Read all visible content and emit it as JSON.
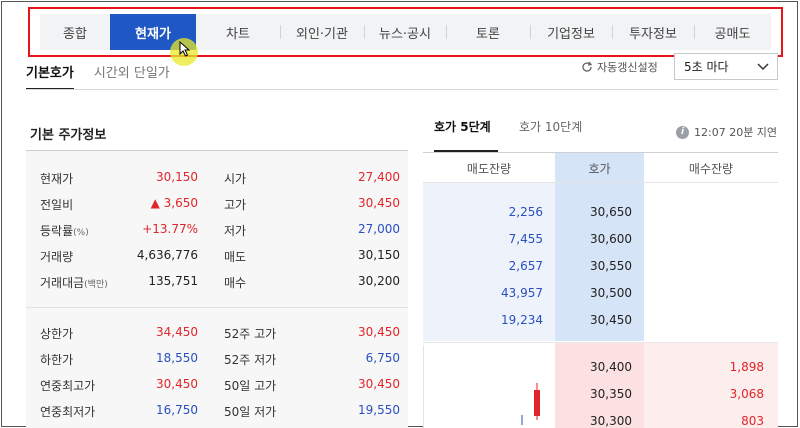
{
  "top_tabs": [
    {
      "label": "종합",
      "active": false
    },
    {
      "label": "현재가",
      "active": true
    },
    {
      "label": "차트",
      "active": false
    },
    {
      "label": "외인·기관",
      "active": false
    },
    {
      "label": "뉴스·공시",
      "active": false
    },
    {
      "label": "토론",
      "active": false
    },
    {
      "label": "기업정보",
      "active": false
    },
    {
      "label": "투자정보",
      "active": false
    },
    {
      "label": "공매도",
      "active": false
    }
  ],
  "sub_tabs": [
    {
      "label": "기본호가",
      "active": true
    },
    {
      "label": "시간외 단일가",
      "active": false
    }
  ],
  "auto_refresh_label": "자동갱신설정",
  "refresh_interval": "5초 마다",
  "left_section": {
    "title": "기본 주가정보",
    "rows_top": [
      {
        "label": "현재가",
        "value": "30,150",
        "color": "red",
        "label2": "시가",
        "value2": "27,400",
        "color2": "red"
      },
      {
        "label": "전일비",
        "value": "▲ 3,650",
        "color": "red",
        "label2": "고가",
        "value2": "30,450",
        "color2": "red"
      },
      {
        "label": "등락률",
        "label_suffix": "(%)",
        "value": "+13.77%",
        "color": "red",
        "label2": "저가",
        "value2": "27,000",
        "color2": "blue"
      },
      {
        "label": "거래량",
        "value": "4,636,776",
        "color": "black",
        "label2": "매도",
        "value2": "30,150",
        "color2": "black"
      },
      {
        "label": "거래대금",
        "label_suffix": "(백만)",
        "value": "135,751",
        "color": "black",
        "label2": "매수",
        "value2": "30,200",
        "color2": "black"
      }
    ],
    "rows_bottom": [
      {
        "label": "상한가",
        "value": "34,450",
        "color": "red",
        "label2": "52주 고가",
        "value2": "30,450",
        "color2": "red"
      },
      {
        "label": "하한가",
        "value": "18,550",
        "color": "blue",
        "label2": "52주 저가",
        "value2": "6,750",
        "color2": "blue"
      },
      {
        "label": "연중최고가",
        "value": "30,450",
        "color": "red",
        "label2": "50일 고가",
        "value2": "30,450",
        "color2": "red"
      },
      {
        "label": "연중최저가",
        "value": "16,750",
        "color": "blue",
        "label2": "50일 저가",
        "value2": "19,550",
        "color2": "blue"
      }
    ]
  },
  "right_section": {
    "tabs": [
      {
        "label": "호가 5단계",
        "active": true
      },
      {
        "label": "호가 10단계",
        "active": false
      }
    ],
    "delay_text": "12:07 20분 지연",
    "headers": [
      "매도잔량",
      "호가",
      "매수잔량"
    ],
    "asks": [
      {
        "volume": "2,256",
        "price": "30,650"
      },
      {
        "volume": "7,455",
        "price": "30,600"
      },
      {
        "volume": "2,657",
        "price": "30,550"
      },
      {
        "volume": "43,957",
        "price": "30,500"
      },
      {
        "volume": "19,234",
        "price": "30,450"
      }
    ],
    "bids": [
      {
        "price": "30,400",
        "volume": "1,898"
      },
      {
        "price": "30,350",
        "volume": "3,068"
      },
      {
        "price": "30,300",
        "volume": "803"
      }
    ]
  },
  "colors": {
    "accent": "#1f58c4",
    "red": "#e1252a",
    "blue": "#2a4fbf",
    "highlight_border": "#e8141b"
  }
}
